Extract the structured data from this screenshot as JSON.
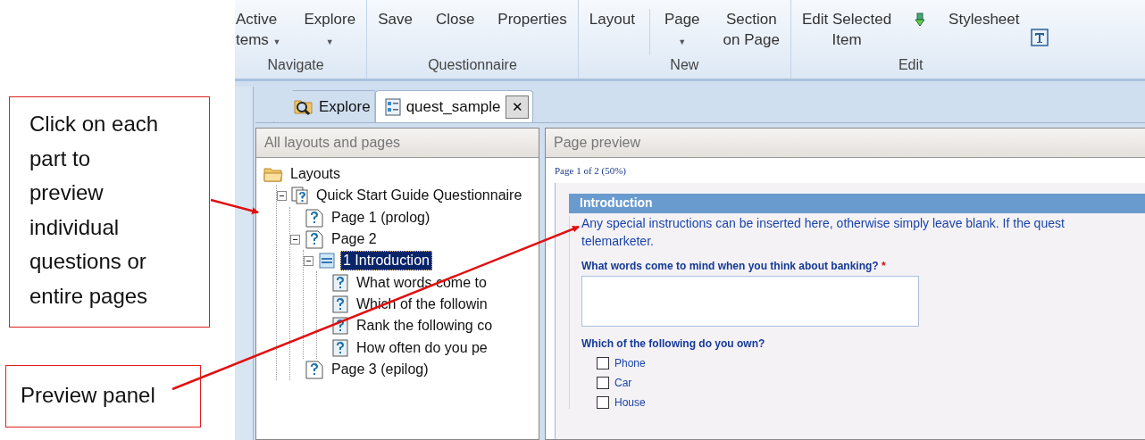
{
  "ribbon": {
    "groups": [
      {
        "label": "Navigate",
        "buttons": [
          {
            "label": "Active",
            "label_2": "tems",
            "caret": "▼"
          },
          {
            "label": "Explore",
            "caret": "▼"
          }
        ]
      },
      {
        "label": "Questionnaire",
        "buttons": [
          {
            "label": "Save"
          },
          {
            "label": "Close"
          },
          {
            "label": "Properties"
          }
        ]
      },
      {
        "label": "New",
        "buttons": [
          {
            "label": "Layout"
          },
          {
            "label": "Page",
            "caret": "▼"
          },
          {
            "label": "Section",
            "label_2": "on Page"
          }
        ]
      },
      {
        "label": "Edit",
        "buttons": [
          {
            "label": "Edit Selected",
            "label_2": "Item"
          },
          {
            "kind": "icon"
          },
          {
            "label": "Stylesheet"
          }
        ]
      }
    ]
  },
  "tabs": [
    {
      "label": "Explore",
      "selected": false
    },
    {
      "label": "quest_sample",
      "selected": true,
      "close": "✕"
    }
  ],
  "tree_panel": {
    "title": "All layouts and pages",
    "items": [
      {
        "label": "Layouts",
        "kind": "folder",
        "selected": false,
        "children": [
          {
            "label": "Quick Start Guide Questionnaire",
            "kind": "questionnaire",
            "selected": false,
            "expanded": true,
            "children": [
              {
                "label": "Page 1 (prolog)",
                "kind": "page",
                "selected": false
              },
              {
                "label": "Page 2",
                "kind": "page",
                "selected": false,
                "expanded": true,
                "children": [
                  {
                    "label": "1 Introduction",
                    "kind": "section",
                    "selected": true,
                    "expanded": true,
                    "children": [
                      {
                        "label": "What words come to",
                        "kind": "question",
                        "selected": false
                      },
                      {
                        "label": "Which of the followin",
                        "kind": "question",
                        "selected": false
                      },
                      {
                        "label": "Rank the following co",
                        "kind": "question",
                        "selected": false
                      },
                      {
                        "label": "How often do you pe",
                        "kind": "question",
                        "selected": false
                      }
                    ]
                  }
                ]
              },
              {
                "label": "Page 3 (epilog)",
                "kind": "page",
                "selected": false
              }
            ]
          }
        ]
      }
    ]
  },
  "preview_panel": {
    "title": "Page preview",
    "page_info": "Page 1 of 2 (50%)",
    "section_title": "Introduction",
    "instructions": [
      "Any special instructions can be inserted here, otherwise simply leave blank. If the quest",
      "telemarketer."
    ],
    "questions": [
      {
        "kind": "text",
        "label": "What words come to mind when you think about banking?",
        "required_mark": "*"
      },
      {
        "kind": "checkboxes",
        "label": "Which of the following do you own?",
        "options": [
          {
            "label": "Phone",
            "checked": false
          },
          {
            "label": "Car",
            "checked": false
          },
          {
            "label": "House",
            "checked": false
          }
        ]
      }
    ]
  },
  "callouts": [
    {
      "text": "Click on each part to preview individual questions or entire pages"
    },
    {
      "text": "Preview panel"
    }
  ]
}
